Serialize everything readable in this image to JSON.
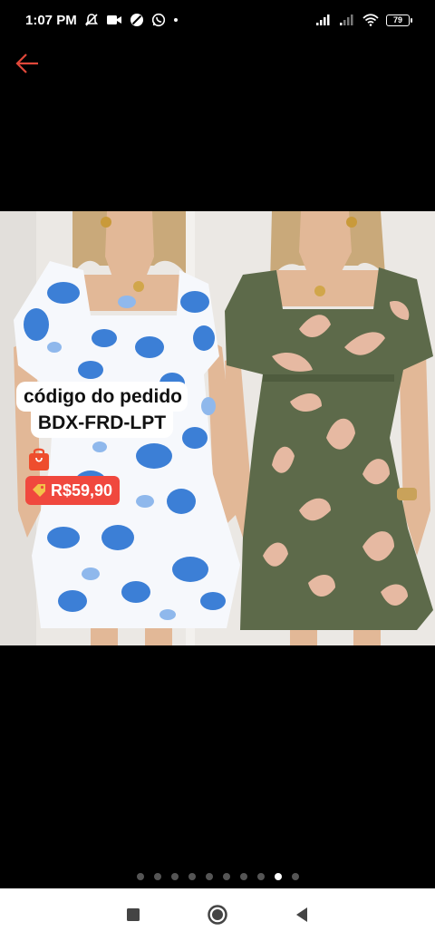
{
  "status_bar": {
    "time": "1:07 PM",
    "icons_left": [
      "mute-alarm-icon",
      "video-icon",
      "block-icon",
      "whatsapp-icon",
      "dot-icon"
    ],
    "icons_right": [
      "signal-icon",
      "signal-weak-icon",
      "wifi-icon",
      "battery-icon"
    ],
    "battery_level": "79"
  },
  "toolbar": {
    "back_icon": "arrow-left-icon",
    "back_color": "#e0483a"
  },
  "product": {
    "order_label_line1": "código do pedido",
    "order_label_line2": "BDX-FRD-LPT",
    "price": "R$59,90",
    "price_color": "#f0483e",
    "tag_icon": "price-tag-icon",
    "bag_icon": "shopping-bag-icon"
  },
  "carousel": {
    "total_pages": 10,
    "active_page": 9
  },
  "nav": {
    "recent_icon": "square-icon",
    "home_icon": "circle-icon",
    "back_icon": "triangle-back-icon"
  }
}
